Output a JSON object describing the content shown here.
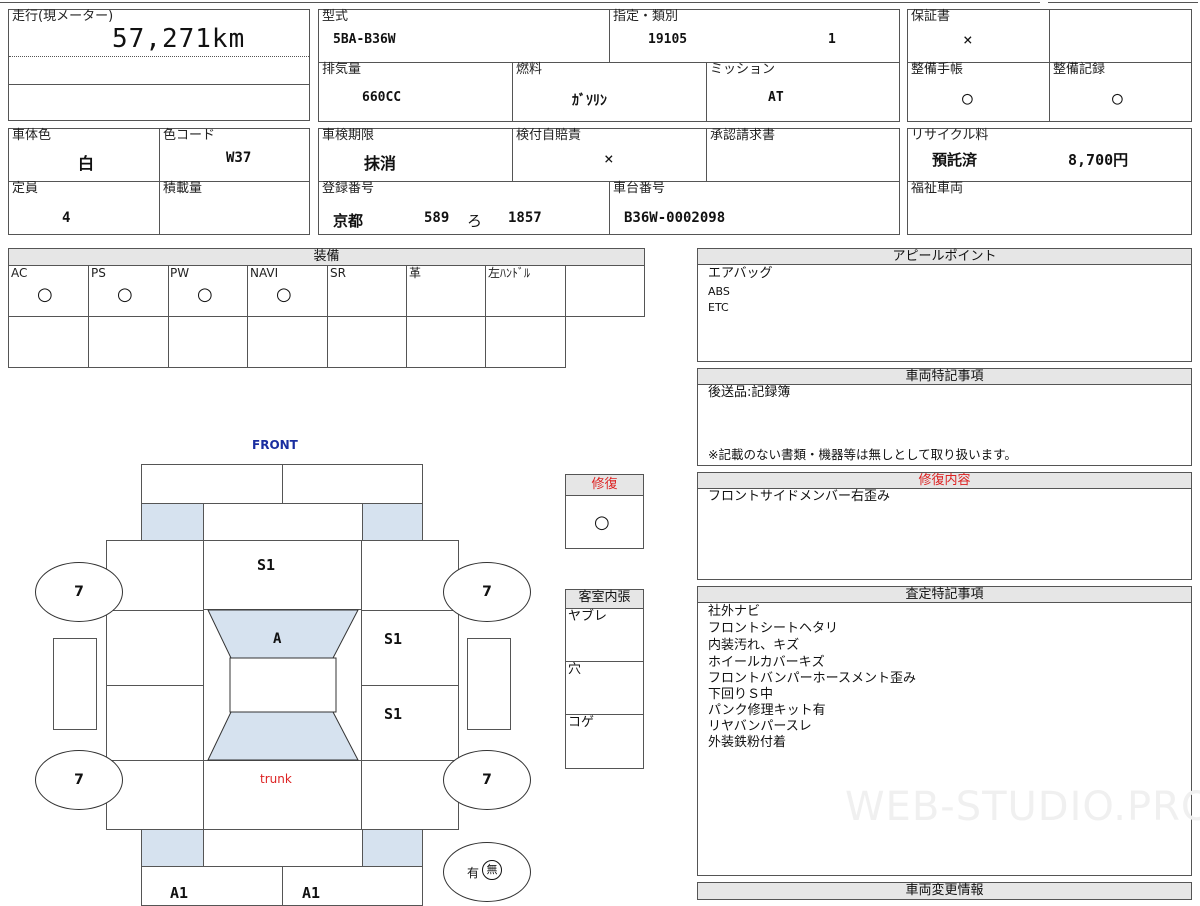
{
  "mileage": {
    "label": "走行(現メーター)",
    "value": "57,271km"
  },
  "model": {
    "label": "型式",
    "value": "5BA-B36W"
  },
  "designation": {
    "label": "指定・類別",
    "value1": "19105",
    "value2": "1"
  },
  "warranty": {
    "label": "保証書",
    "value": "×"
  },
  "displacement": {
    "label": "排気量",
    "value": "660CC"
  },
  "fuel": {
    "label": "燃料",
    "value": "ｶﾞｿﾘﾝ"
  },
  "transmission": {
    "label": "ミッション",
    "value": "AT"
  },
  "maintenance_book": {
    "label": "整備手帳",
    "value": "○"
  },
  "maintenance_record": {
    "label": "整備記録",
    "value": "○"
  },
  "body_color": {
    "label": "車体色",
    "value": "白"
  },
  "color_code": {
    "label": "色コード",
    "value": "W37"
  },
  "inspection": {
    "label": "車検期限",
    "value": "抹消"
  },
  "insurance": {
    "label": "検付自賠責",
    "value": "×"
  },
  "approval": {
    "label": "承認請求書",
    "value": ""
  },
  "recycle": {
    "label": "リサイクル料",
    "status": "預託済",
    "amount": "8,700円"
  },
  "capacity": {
    "label": "定員",
    "value": "4"
  },
  "load": {
    "label": "積載量",
    "value": ""
  },
  "registration": {
    "label": "登録番号",
    "region": "京都",
    "class": "589",
    "kana": "ろ",
    "number": "1857"
  },
  "chassis": {
    "label": "車台番号",
    "value": "B36W-0002098"
  },
  "welfare": {
    "label": "福祉車両",
    "value": ""
  },
  "equipment": {
    "title": "装備",
    "items": [
      {
        "label": "AC",
        "mark": "○"
      },
      {
        "label": "PS",
        "mark": "○"
      },
      {
        "label": "PW",
        "mark": "○"
      },
      {
        "label": "NAVI",
        "mark": "○"
      },
      {
        "label": "SR",
        "mark": ""
      },
      {
        "label": "革",
        "mark": ""
      },
      {
        "label": "左ﾊﾝﾄﾞﾙ",
        "mark": ""
      },
      {
        "label": "",
        "mark": ""
      }
    ]
  },
  "appeal": {
    "title": "アピールポイント",
    "lines": [
      "エアバッグ",
      "ABS",
      "ETC"
    ]
  },
  "special_notes": {
    "title": "車両特記事項",
    "line1": "後送品:記録簿",
    "footnote": "※記載のない書類・機器等は無しとして取り扱います。"
  },
  "repair": {
    "label": "修復",
    "value": "○"
  },
  "repair_detail": {
    "title": "修復内容",
    "text": "フロントサイドメンバー右歪み"
  },
  "interior": {
    "title": "客室内張",
    "items": [
      "ヤブレ",
      "穴",
      "コゲ"
    ]
  },
  "assessment": {
    "title": "査定特記事項",
    "lines": [
      "社外ナビ",
      "フロントシートヘタリ",
      "内装汚れ、キズ",
      "ホイールカバーキズ",
      "フロントバンパーホースメント歪み",
      "下回りＳ中",
      "パンク修理キット有",
      "リヤバンパースレ",
      "外装鉄粉付着"
    ]
  },
  "change_info": {
    "title": "車両変更情報"
  },
  "diagram": {
    "front": "FRONT",
    "trunk": "trunk",
    "marks": {
      "hood": "S1",
      "roof": "A",
      "right_front_door": "S1",
      "right_rear_door": "S1",
      "rear_left": "A1",
      "rear_right": "A1"
    },
    "wheels": [
      "7",
      "7",
      "7",
      "7"
    ],
    "spare_tire": {
      "have": "有",
      "none": "無"
    }
  },
  "watermark": "WEB-STUDIO.PRO"
}
